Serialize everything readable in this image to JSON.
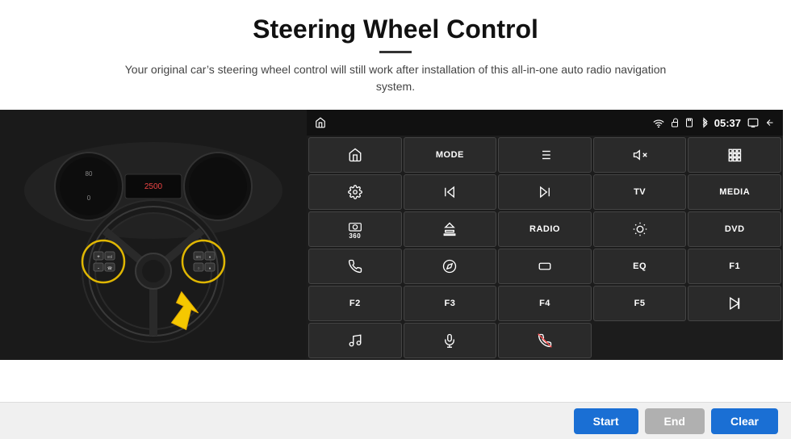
{
  "header": {
    "title": "Steering Wheel Control",
    "subtitle": "Your original car’s steering wheel control will still work after installation of this all-in-one auto radio navigation system."
  },
  "status_bar": {
    "time": "05:37",
    "icons": [
      "wifi",
      "lock",
      "sd",
      "bluetooth",
      "screen",
      "back"
    ]
  },
  "grid_buttons": [
    {
      "id": "r1c1",
      "type": "icon",
      "label": "home",
      "icon": "home"
    },
    {
      "id": "r1c2",
      "type": "text",
      "label": "MODE"
    },
    {
      "id": "r1c3",
      "type": "icon",
      "label": "list",
      "icon": "list"
    },
    {
      "id": "r1c4",
      "type": "icon",
      "label": "volume-mute",
      "icon": "vol-mute"
    },
    {
      "id": "r1c5",
      "type": "icon",
      "label": "apps",
      "icon": "apps"
    },
    {
      "id": "r2c1",
      "type": "icon",
      "label": "settings",
      "icon": "settings"
    },
    {
      "id": "r2c2",
      "type": "icon",
      "label": "rewind",
      "icon": "rewind"
    },
    {
      "id": "r2c3",
      "type": "icon",
      "label": "fast-forward",
      "icon": "fastforward"
    },
    {
      "id": "r2c4",
      "type": "text",
      "label": "TV"
    },
    {
      "id": "r2c5",
      "type": "text",
      "label": "MEDIA"
    },
    {
      "id": "r3c1",
      "type": "icon",
      "label": "camera360",
      "icon": "camera360"
    },
    {
      "id": "r3c2",
      "type": "icon",
      "label": "eject",
      "icon": "eject"
    },
    {
      "id": "r3c3",
      "type": "text",
      "label": "RADIO"
    },
    {
      "id": "r3c4",
      "type": "icon",
      "label": "brightness",
      "icon": "brightness"
    },
    {
      "id": "r3c5",
      "type": "text",
      "label": "DVD"
    },
    {
      "id": "r4c1",
      "type": "icon",
      "label": "phone",
      "icon": "phone"
    },
    {
      "id": "r4c2",
      "type": "icon",
      "label": "compass",
      "icon": "compass"
    },
    {
      "id": "r4c3",
      "type": "icon",
      "label": "rectangle",
      "icon": "rect"
    },
    {
      "id": "r4c4",
      "type": "text",
      "label": "EQ"
    },
    {
      "id": "r4c5",
      "type": "text",
      "label": "F1"
    },
    {
      "id": "r5c1",
      "type": "text",
      "label": "F2"
    },
    {
      "id": "r5c2",
      "type": "text",
      "label": "F3"
    },
    {
      "id": "r5c3",
      "type": "text",
      "label": "F4"
    },
    {
      "id": "r5c4",
      "type": "text",
      "label": "F5"
    },
    {
      "id": "r5c5",
      "type": "icon",
      "label": "play-pause",
      "icon": "playpause"
    },
    {
      "id": "r6c1",
      "type": "icon",
      "label": "music",
      "icon": "music"
    },
    {
      "id": "r6c2",
      "type": "icon",
      "label": "microphone",
      "icon": "mic"
    },
    {
      "id": "r6c3",
      "type": "icon",
      "label": "phone-answer",
      "icon": "phone-ans"
    }
  ],
  "bottom_bar": {
    "start_label": "Start",
    "end_label": "End",
    "clear_label": "Clear"
  }
}
